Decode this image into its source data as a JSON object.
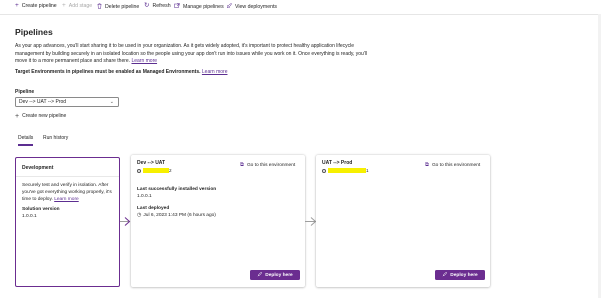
{
  "toolbar": {
    "items": [
      {
        "label": "Create pipeline",
        "icon": "plus-icon",
        "disabled": false
      },
      {
        "label": "Add stage",
        "icon": "plus-icon",
        "disabled": true
      },
      {
        "label": "Delete pipeline",
        "icon": "trash-icon",
        "disabled": false
      },
      {
        "label": "Refresh",
        "icon": "refresh-icon",
        "disabled": false
      },
      {
        "label": "Manage pipelines",
        "icon": "external-link-icon",
        "disabled": false
      },
      {
        "label": "View deployments",
        "icon": "rocket-icon",
        "disabled": false
      }
    ]
  },
  "page": {
    "title": "Pipelines",
    "description": "As your app advances, you'll start sharing it to be used in your organization. As it gets widely adopted, it's important to protect healthy application lifecycle management by building securely in an isolated location so the people using your app don't run into issues while you work on it. Once everything is ready, you'll move it to a more permanent place and share there.",
    "learn_more": "Learn more",
    "warning": "Target Environments in pipelines must be enabled as Managed Environments.",
    "warning_link": "Learn more"
  },
  "pipeline_select": {
    "label": "Pipeline",
    "value": "Dev --> UAT --> Prod",
    "create_label": "Create new pipeline"
  },
  "tabs": [
    {
      "label": "Details",
      "selected": true
    },
    {
      "label": "Run history",
      "selected": false
    }
  ],
  "development": {
    "title": "Development",
    "text": "Securely test and verify in isolation. After you've got everything working properly, it's time to deploy.",
    "learn_more": "Learn more",
    "solution_version_label": "Solution version",
    "solution_version": "1.0.0.1"
  },
  "stages": [
    {
      "name": "Dev --> UAT",
      "env_suffix": "2",
      "goto_label": "Go to this environment",
      "last_installed_label": "Last successfully installed version",
      "last_installed": "1.0.0.1",
      "last_deployed_label": "Last deployed",
      "last_deployed": "Jul 6, 2023 1:43 PM (6 hours ago)",
      "deploy_label": "Deploy here"
    },
    {
      "name": "UAT --> Prod",
      "env_suffix": "1",
      "goto_label": "Go to this environment",
      "deploy_label": "Deploy here"
    }
  ],
  "colors": {
    "accent": "#6b2d90",
    "highlight": "#f7f000"
  }
}
